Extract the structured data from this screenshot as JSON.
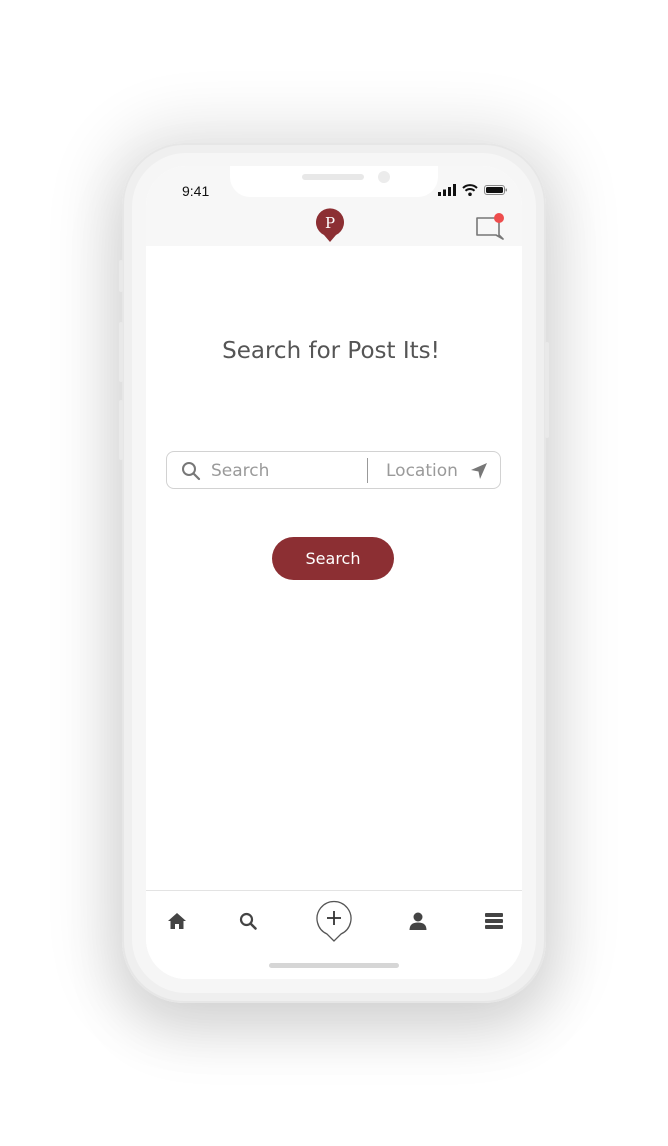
{
  "status_bar": {
    "time": "9:41"
  },
  "header": {
    "logo_letter": "P",
    "brand_color": "#8c2f33",
    "notification_dot_color": "#ee4d4d"
  },
  "main": {
    "title": "Search for Post Its!",
    "search_placeholder": "Search",
    "location_placeholder": "Location",
    "search_button_label": "Search"
  },
  "bottom_nav": {
    "items": [
      {
        "icon": "home-icon"
      },
      {
        "icon": "search-icon"
      },
      {
        "icon": "add-post-icon"
      },
      {
        "icon": "profile-icon"
      },
      {
        "icon": "menu-icon"
      }
    ]
  }
}
